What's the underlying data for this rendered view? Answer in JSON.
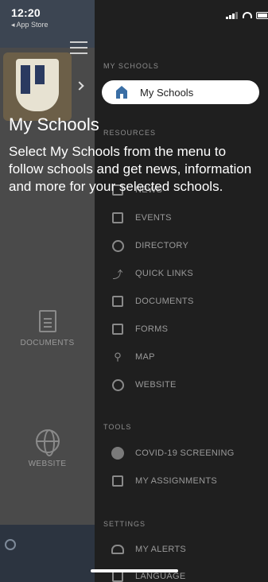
{
  "status_bar": {
    "time": "12:20",
    "back_app": "◂ App Store"
  },
  "drawer": {
    "sections": [
      {
        "header": "MY SCHOOLS"
      },
      {
        "header": "RESOURCES"
      },
      {
        "header": "TOOLS"
      },
      {
        "header": "SETTINGS"
      }
    ],
    "highlighted_item": {
      "label": "My Schools",
      "icon": "school-icon"
    },
    "resources_items": [
      {
        "label": "NEWS",
        "icon": "news-icon"
      },
      {
        "label": "EVENTS",
        "icon": "calendar-icon"
      },
      {
        "label": "DIRECTORY",
        "icon": "directory-icon"
      },
      {
        "label": "QUICK LINKS",
        "icon": "link-icon"
      },
      {
        "label": "DOCUMENTS",
        "icon": "document-icon"
      },
      {
        "label": "FORMS",
        "icon": "form-icon"
      },
      {
        "label": "MAP",
        "icon": "map-pin-icon"
      },
      {
        "label": "WEBSITE",
        "icon": "globe-icon"
      }
    ],
    "tools_items": [
      {
        "label": "COVID-19 SCREENING",
        "icon": "screening-icon"
      },
      {
        "label": "MY ASSIGNMENTS",
        "icon": "assignments-icon"
      }
    ],
    "settings_items": [
      {
        "label": "MY ALERTS",
        "icon": "bell-icon"
      },
      {
        "label": "LANGUAGE",
        "icon": "language-icon"
      }
    ]
  },
  "left_screen": {
    "tiles": [
      {
        "label": "DOCUMENTS",
        "icon": "document-icon"
      },
      {
        "label": "WEBSITE",
        "icon": "globe-icon"
      }
    ]
  },
  "tutorial": {
    "title": "My Schools",
    "description": "Select My Schools from the menu to follow schools and get news, information and more for your selected schools."
  }
}
